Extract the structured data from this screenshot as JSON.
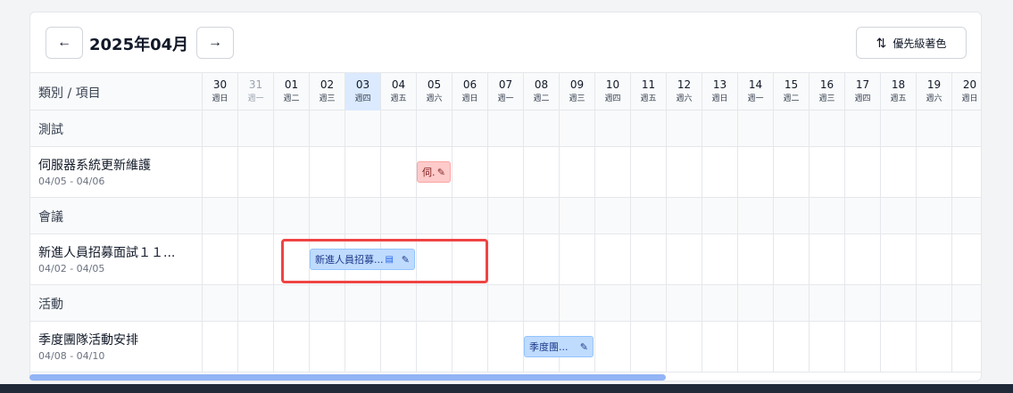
{
  "header": {
    "prev_label": "←",
    "next_label": "→",
    "month_title": "2025年04月",
    "priority_icon": "⇅",
    "priority_label": "優先級著色"
  },
  "grid": {
    "column_label": "類別 / 項目",
    "days": [
      {
        "d": "30",
        "w": "週日",
        "muted": false
      },
      {
        "d": "31",
        "w": "週一",
        "muted": true
      },
      {
        "d": "01",
        "w": "週二",
        "muted": false
      },
      {
        "d": "02",
        "w": "週三",
        "muted": false
      },
      {
        "d": "03",
        "w": "週四",
        "muted": false,
        "today": true
      },
      {
        "d": "04",
        "w": "週五",
        "muted": false
      },
      {
        "d": "05",
        "w": "週六",
        "muted": false
      },
      {
        "d": "06",
        "w": "週日",
        "muted": false
      },
      {
        "d": "07",
        "w": "週一",
        "muted": false
      },
      {
        "d": "08",
        "w": "週二",
        "muted": false
      },
      {
        "d": "09",
        "w": "週三",
        "muted": false
      },
      {
        "d": "10",
        "w": "週四",
        "muted": false
      },
      {
        "d": "11",
        "w": "週五",
        "muted": false
      },
      {
        "d": "12",
        "w": "週六",
        "muted": false
      },
      {
        "d": "13",
        "w": "週日",
        "muted": false
      },
      {
        "d": "14",
        "w": "週一",
        "muted": false
      },
      {
        "d": "15",
        "w": "週二",
        "muted": false
      },
      {
        "d": "16",
        "w": "週三",
        "muted": false
      },
      {
        "d": "17",
        "w": "週四",
        "muted": false
      },
      {
        "d": "18",
        "w": "週五",
        "muted": false
      },
      {
        "d": "19",
        "w": "週六",
        "muted": false
      },
      {
        "d": "20",
        "w": "週日",
        "muted": false
      }
    ]
  },
  "categories": [
    {
      "label": "測試",
      "item": {
        "title": "伺服器系統更新維護",
        "range": "04/05 - 04/06",
        "bar_label": "伺.",
        "bar_color": "red"
      }
    },
    {
      "label": "會議",
      "item": {
        "title": "新進人員招募面試１１...",
        "range": "04/02 - 04/05",
        "bar_label": "新進人員招募...",
        "bar_color": "blue"
      }
    },
    {
      "label": "活動",
      "item": {
        "title": "季度團隊活動安排",
        "range": "04/08 - 04/10",
        "bar_label": "季度團...",
        "bar_color": "blue"
      }
    }
  ],
  "icons": {
    "edit": "edit-icon",
    "calendar": "calendar-icon"
  },
  "colors": {
    "today": "#dbeafe",
    "highlight": "#ef4444",
    "scrollbar": "#93b4f5"
  }
}
